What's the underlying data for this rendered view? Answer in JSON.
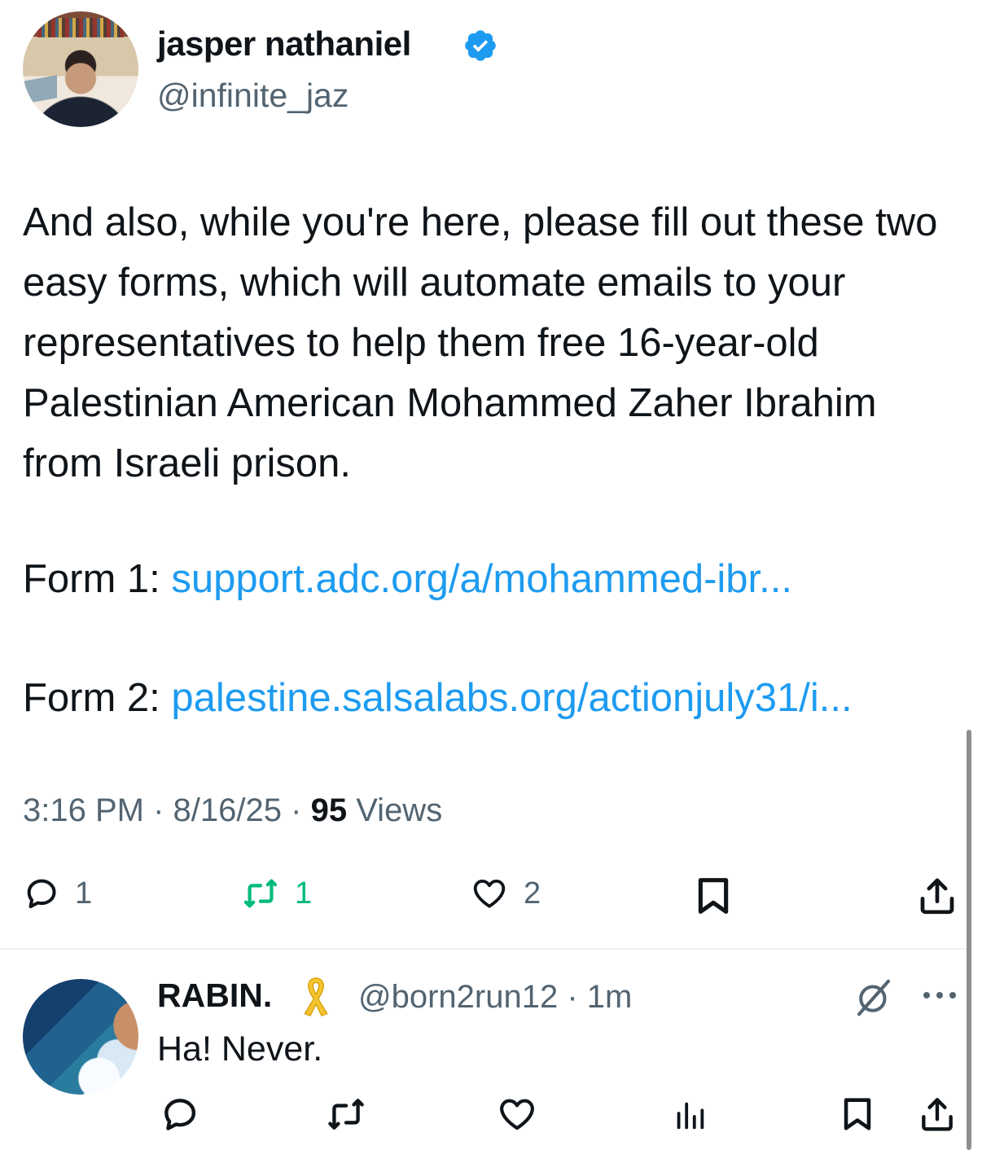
{
  "tweet": {
    "author_name": "jasper nathaniel",
    "author_handle": "@infinite_jaz",
    "body": "And also, while you're here, please fill out these two easy forms, which will automate emails to your representatives to help them free 16-year-old Palestinian American Mohammed Zaher Ibrahim from Israeli prison.",
    "form1_label": "Form 1:",
    "form1_link": "support.adc.org/a/mohammed-ibr...",
    "form2_label": "Form 2:",
    "form2_link": "palestine.salsalabs.org/actionjuly31/i...",
    "time": "3:16 PM",
    "date": "8/16/25",
    "views_count": "95",
    "views_label": "Views",
    "separator": "·",
    "replies": "1",
    "retweets": "1",
    "likes": "2"
  },
  "reply": {
    "author_name": "RABIN.",
    "author_handle": "@born2run12",
    "time": "1m",
    "separator": "·",
    "text": "Ha! Never."
  },
  "icons": {
    "verified": "verified-badge-icon",
    "reply": "comment-icon",
    "retweet": "retweet-icon",
    "like": "heart-icon",
    "bookmark": "bookmark-icon",
    "share": "share-icon",
    "ribbon": "yellow-ribbon-icon",
    "grok": "grok-icon",
    "more": "more-icon",
    "views": "views-icon"
  },
  "colors": {
    "text": "#0f1419",
    "secondary": "#536471",
    "link": "#1d9bf0",
    "retweet_active": "#00ba7c",
    "verified": "#1d9bf0",
    "ribbon": "#f4c430"
  }
}
